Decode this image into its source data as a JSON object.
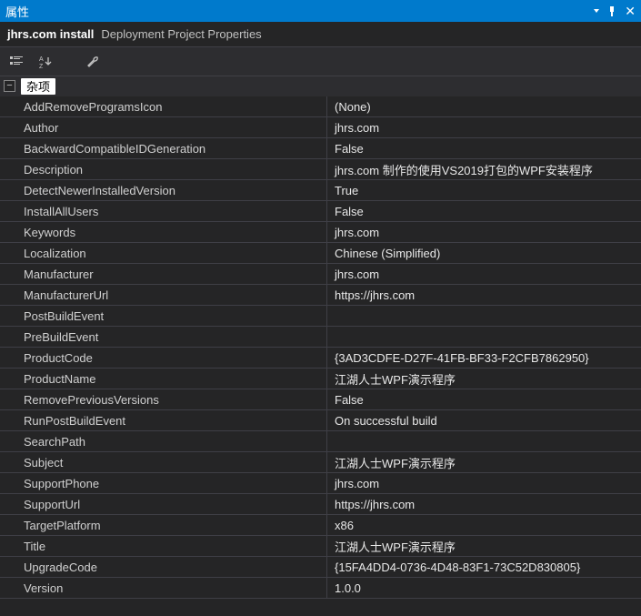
{
  "title": "属性",
  "header": {
    "object": "jhrs.com install",
    "type": "Deployment Project Properties"
  },
  "category": "杂项",
  "properties": [
    {
      "name": "AddRemoveProgramsIcon",
      "value": "(None)"
    },
    {
      "name": "Author",
      "value": "jhrs.com"
    },
    {
      "name": "BackwardCompatibleIDGeneration",
      "value": "False"
    },
    {
      "name": "Description",
      "value": "jhrs.com 制作的使用VS2019打包的WPF安装程序"
    },
    {
      "name": "DetectNewerInstalledVersion",
      "value": "True"
    },
    {
      "name": "InstallAllUsers",
      "value": "False"
    },
    {
      "name": "Keywords",
      "value": "jhrs.com"
    },
    {
      "name": "Localization",
      "value": "Chinese (Simplified)"
    },
    {
      "name": "Manufacturer",
      "value": "jhrs.com"
    },
    {
      "name": "ManufacturerUrl",
      "value": "https://jhrs.com"
    },
    {
      "name": "PostBuildEvent",
      "value": ""
    },
    {
      "name": "PreBuildEvent",
      "value": ""
    },
    {
      "name": "ProductCode",
      "value": "{3AD3CDFE-D27F-41FB-BF33-F2CFB7862950}"
    },
    {
      "name": "ProductName",
      "value": "江湖人士WPF演示程序"
    },
    {
      "name": "RemovePreviousVersions",
      "value": "False"
    },
    {
      "name": "RunPostBuildEvent",
      "value": "On successful build"
    },
    {
      "name": "SearchPath",
      "value": ""
    },
    {
      "name": "Subject",
      "value": "江湖人士WPF演示程序"
    },
    {
      "name": "SupportPhone",
      "value": "jhrs.com"
    },
    {
      "name": "SupportUrl",
      "value": "https://jhrs.com"
    },
    {
      "name": "TargetPlatform",
      "value": "x86"
    },
    {
      "name": "Title",
      "value": "江湖人士WPF演示程序"
    },
    {
      "name": "UpgradeCode",
      "value": "{15FA4DD4-0736-4D48-83F1-73C52D830805}"
    },
    {
      "name": "Version",
      "value": "1.0.0"
    }
  ]
}
